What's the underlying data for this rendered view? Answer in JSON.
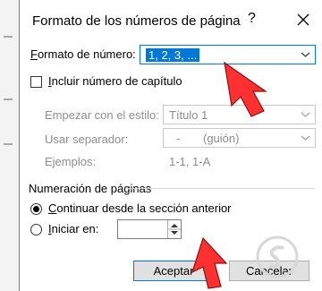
{
  "dialog": {
    "title": "Formato de los números de página",
    "help": "?",
    "close_icon": "close-icon"
  },
  "format": {
    "label_prefix": "F",
    "label_rest": "ormato de número:",
    "value": "1, 2, 3, ..."
  },
  "chapter": {
    "checkbox_label_prefix": "I",
    "checkbox_label_rest": "ncluir número de capítulo",
    "checked": false,
    "style_label": "Empezar con el estilo:",
    "style_value": "Título 1",
    "separator_label": "Usar separador:",
    "separator_value": "-",
    "separator_name": "(guión)",
    "examples_label": "Ejemplos:",
    "examples_value": "1-1, 1-A"
  },
  "numbering": {
    "section_title": "Numeración de páginas",
    "continue_prefix": "C",
    "continue_rest": "ontinuar desde la sección anterior",
    "continue_selected": true,
    "start_prefix": "I",
    "start_rest": "niciar en:",
    "start_selected": false,
    "start_value": ""
  },
  "buttons": {
    "ok": "Aceptar",
    "cancel": "Cancelar"
  },
  "colors": {
    "accent": "#0078d7",
    "overlay_arrow": "#ff3030",
    "disabled_text": "#8d8d8d"
  }
}
